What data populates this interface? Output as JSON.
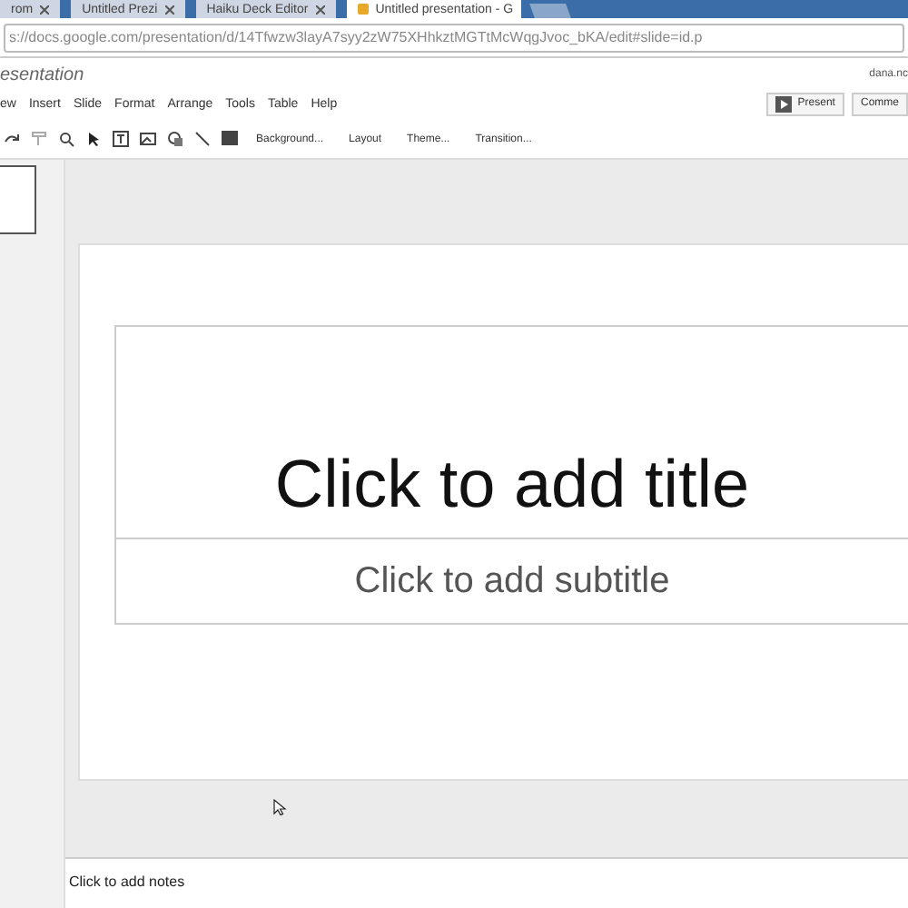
{
  "browser_tabs": [
    {
      "title": "rom",
      "selected": false
    },
    {
      "title": "Untitled Prezi",
      "selected": false
    },
    {
      "title": "Haiku Deck Editor",
      "selected": false
    },
    {
      "title": "Untitled presentation - G",
      "selected": true
    }
  ],
  "address": "s://docs.google.com/presentation/d/14Tfwzw3layA7syy2zW75XHhkztMGTtMcWqgJvoc_bKA/edit#slide=id.p",
  "doc_title": "esentation",
  "user": "dana.nc",
  "menu": [
    "ew",
    "Insert",
    "Slide",
    "Format",
    "Arrange",
    "Tools",
    "Table",
    "Help"
  ],
  "present_button": "Present",
  "comments_button": "Comme",
  "toolbar_buttons": [
    "Background...",
    "Layout",
    "Theme...",
    "Transition..."
  ],
  "slide": {
    "title_placeholder": "Click to add title",
    "subtitle_placeholder": "Click to add subtitle"
  },
  "notes_placeholder": "Click to add notes"
}
